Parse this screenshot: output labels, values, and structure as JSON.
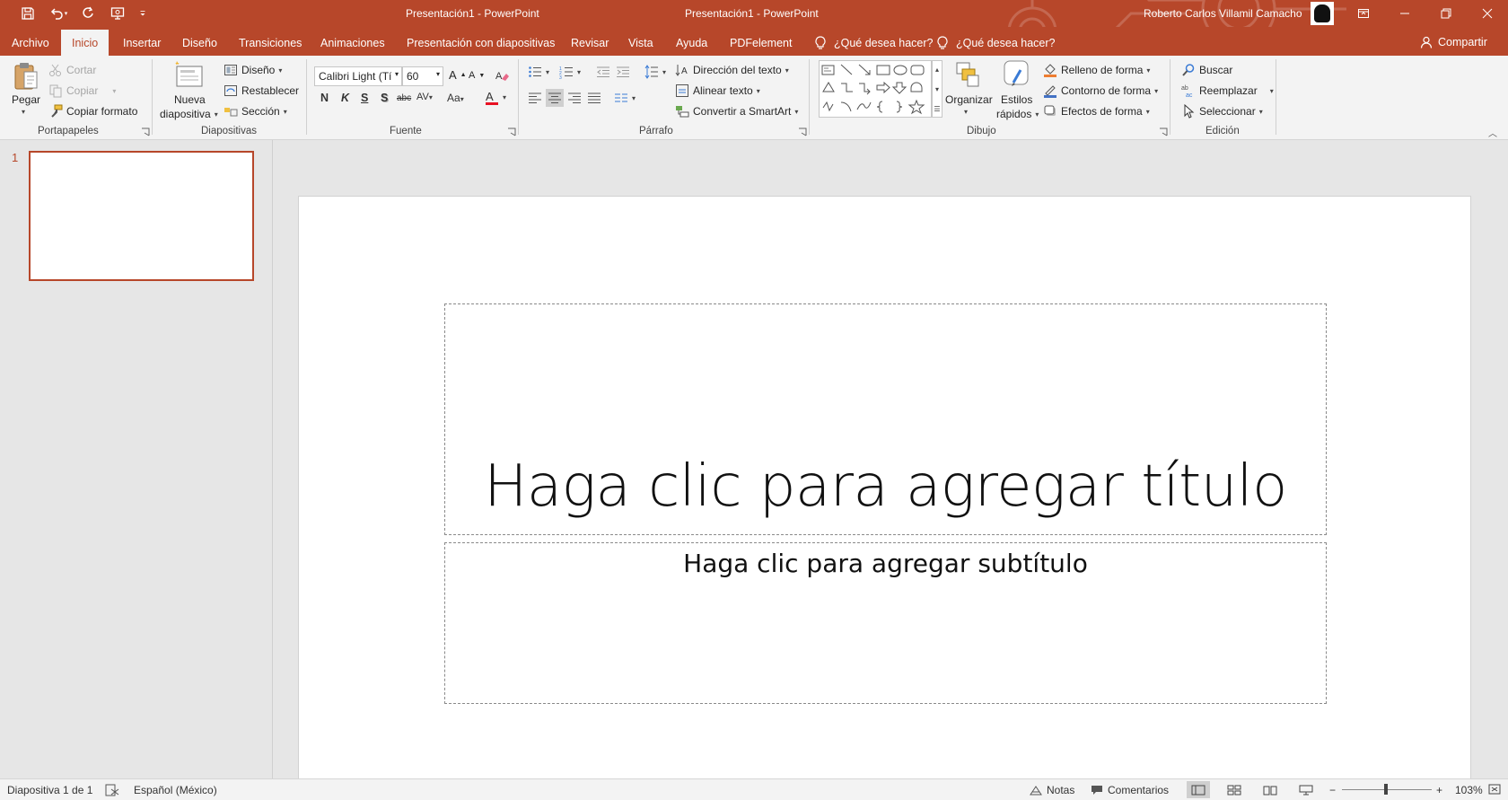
{
  "window": {
    "title_left": "Presentación1  -  PowerPoint",
    "title_right": "Presentación1  -  PowerPoint",
    "user": "Roberto Carlos Villamil Camacho",
    "accent": "#b7472a"
  },
  "tabs": {
    "archivo": "Archivo",
    "inicio": "Inicio",
    "insertar": "Insertar",
    "diseno": "Diseño",
    "transiciones": "Transiciones",
    "animaciones": "Animaciones",
    "presentacion": "Presentación con diapositivas",
    "revisar": "Revisar",
    "vista": "Vista",
    "ayuda": "Ayuda",
    "pdfelement": "PDFelement",
    "tell1": "¿Qué desea hacer?",
    "tell2": "¿Qué desea hacer?",
    "share": "Compartir"
  },
  "ribbon": {
    "portapapeles": {
      "label": "Portapapeles",
      "pegar": "Pegar",
      "cortar": "Cortar",
      "copiar": "Copiar",
      "copiar_formato": "Copiar formato"
    },
    "diapositivas": {
      "label": "Diapositivas",
      "nueva_1": "Nueva",
      "nueva_2": "diapositiva",
      "diseno": "Diseño",
      "restablecer": "Restablecer",
      "seccion": "Sección"
    },
    "fuente": {
      "label": "Fuente",
      "font_name": "Calibri Light (Tí",
      "font_size": "60",
      "bold": "N",
      "italic": "K",
      "underline": "S",
      "shadow": "S",
      "strike": "abc",
      "spacing": "AV",
      "case": "Aa",
      "color_letter": "A",
      "color": "#e81123"
    },
    "parrafo": {
      "label": "Párrafo",
      "direccion": "Dirección del texto",
      "alinear": "Alinear texto",
      "smartart": "Convertir a SmartArt"
    },
    "dibujo": {
      "label": "Dibujo",
      "organizar": "Organizar",
      "estilos_1": "Estilos",
      "estilos_2": "rápidos",
      "relleno": "Relleno de forma",
      "contorno": "Contorno de forma",
      "efectos": "Efectos de forma"
    },
    "edicion": {
      "label": "Edición",
      "buscar": "Buscar",
      "reemplazar": "Reemplazar",
      "seleccionar": "Seleccionar"
    }
  },
  "thumbnails": [
    {
      "number": "1"
    }
  ],
  "slide": {
    "title_placeholder": "Haga clic para agregar título",
    "subtitle_placeholder": "Haga clic para agregar subtítulo"
  },
  "status": {
    "slide_info": "Diapositiva 1 de 1",
    "language": "Español (México)",
    "notas": "Notas",
    "comentarios": "Comentarios",
    "zoom": "103%"
  }
}
